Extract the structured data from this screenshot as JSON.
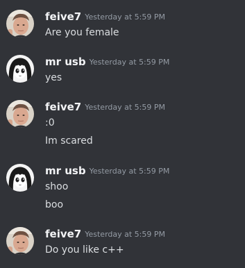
{
  "messages": [
    {
      "username": "feive7",
      "timestamp": "Yesterday at 5:59 PM",
      "avatar_icon": "face-photo-icon",
      "lines": [
        "Are you female"
      ]
    },
    {
      "username": "mr usb",
      "timestamp": "Yesterday at 5:59 PM",
      "avatar_icon": "anime-girl-icon",
      "lines": [
        "yes"
      ]
    },
    {
      "username": "feive7",
      "timestamp": "Yesterday at 5:59 PM",
      "avatar_icon": "face-photo-icon",
      "lines": [
        ":0",
        "Im scared"
      ]
    },
    {
      "username": "mr usb",
      "timestamp": "Yesterday at 5:59 PM",
      "avatar_icon": "anime-girl-icon",
      "lines": [
        "shoo",
        "boo"
      ]
    },
    {
      "username": "feive7",
      "timestamp": "Yesterday at 5:59 PM",
      "avatar_icon": "face-photo-icon",
      "lines": [
        "Do you like c++"
      ]
    }
  ],
  "colors": {
    "background": "#313338",
    "username": "#f2f3f5",
    "timestamp": "#949ba4",
    "message_text": "#dbdee1"
  }
}
